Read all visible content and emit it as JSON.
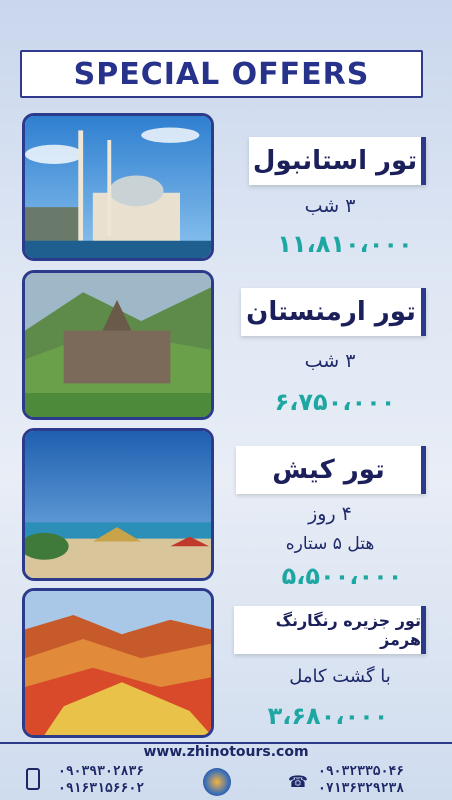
{
  "header": {
    "title": "SPECIAL OFFERS"
  },
  "offers": [
    {
      "title": "تور استانبول",
      "subtitle": "۳ شب",
      "price": "۱۱،۸۱۰،۰۰۰"
    },
    {
      "title": "تور ارمنستان",
      "subtitle": "۳ شب",
      "price": "۶،۷۵۰،۰۰۰"
    },
    {
      "title": "تور کیش",
      "subtitle": "۴ روز",
      "subtitle2": "هتل ۵ ستاره",
      "price": "۵،۵۰۰،۰۰۰"
    },
    {
      "title": "تور جزیره رنگارنگ هرمز",
      "subtitle": "با گشت کامل",
      "price": "۳،۶۸۰،۰۰۰"
    }
  ],
  "footer": {
    "url": "www.zhinotours.com",
    "mobile1": "۰۹۰۳۹۳۰۲۸۳۶",
    "mobile2": "۰۹۱۶۳۱۵۶۶۰۲",
    "phone1": "۰۹۰۳۲۳۳۵۰۴۶",
    "phone2": "۰۷۱۳۶۳۲۹۲۳۸"
  },
  "icons": {
    "mobile": "mobile-phone-icon",
    "phone": "telephone-icon",
    "logo": "plane-globe-logo"
  },
  "colors": {
    "navy": "#2c3a8c",
    "teal": "#1ea7a2",
    "title_text": "#1b1f5a"
  }
}
